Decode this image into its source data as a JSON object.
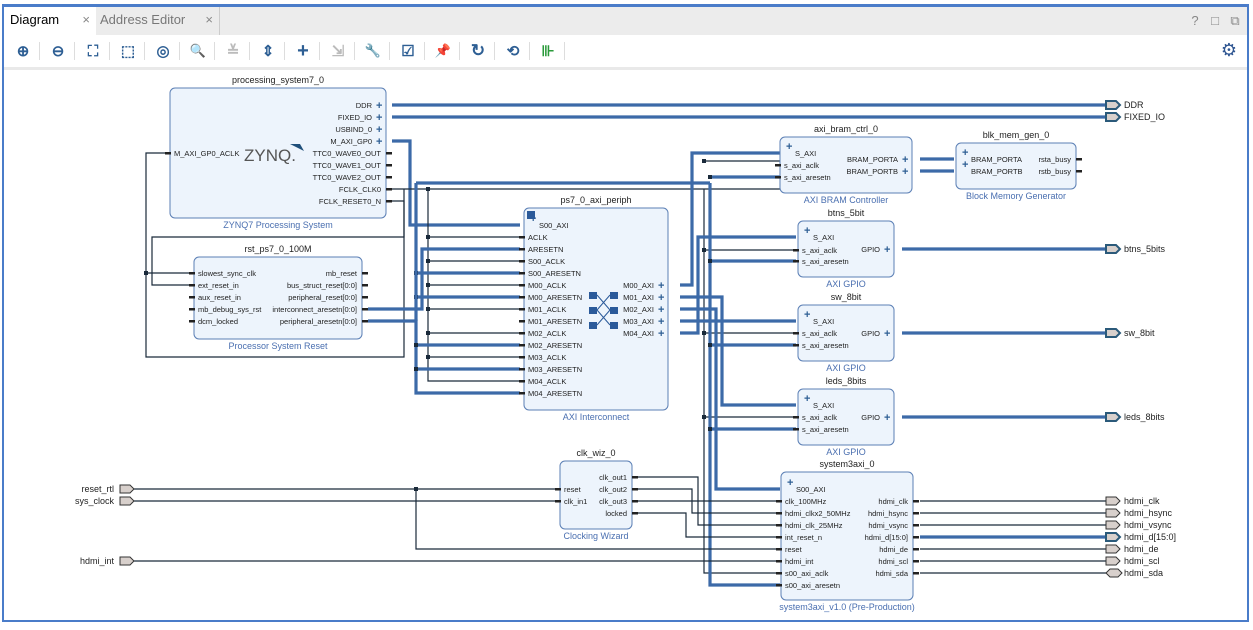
{
  "tabs": [
    {
      "label": "Diagram",
      "active": true,
      "close": "×"
    },
    {
      "label": "Address Editor",
      "active": false,
      "close": "×"
    }
  ],
  "window_controls": {
    "help": "?",
    "maximize": "□",
    "float": "⧉"
  },
  "toolbar": {
    "buttons": [
      {
        "name": "zoom-in",
        "glyph": "⊕"
      },
      {
        "name": "zoom-out",
        "glyph": "⊖"
      },
      {
        "name": "zoom-fit",
        "glyph": "⛶"
      },
      {
        "name": "zoom-area",
        "glyph": "⬚"
      },
      {
        "name": "auto-fit-selection",
        "glyph": "◎"
      },
      {
        "name": "search",
        "glyph": "🔍"
      },
      {
        "name": "collapse-all",
        "glyph": "≚"
      },
      {
        "name": "expand-all",
        "glyph": "⇕"
      },
      {
        "name": "add-ip",
        "glyph": "+"
      },
      {
        "name": "make-external",
        "glyph": "⇲"
      },
      {
        "name": "properties",
        "glyph": "🔧"
      },
      {
        "name": "validate-design",
        "glyph": "☑"
      },
      {
        "name": "pin",
        "glyph": "📌"
      },
      {
        "name": "refresh",
        "glyph": "↻"
      },
      {
        "name": "regenerate-layout",
        "glyph": "⟲"
      },
      {
        "name": "debug",
        "glyph": "⊪"
      }
    ],
    "settings_glyph": "⚙"
  },
  "diagram": {
    "blocks": {
      "ps7": {
        "instance": "processing_system7_0",
        "type": "ZYNQ7 Processing System",
        "logo": "ZYNQ.",
        "inputs": [
          "M_AXI_GP0_ACLK"
        ],
        "outputs": [
          "DDR",
          "FIXED_IO",
          "USBIND_0",
          "M_AXI_GP0",
          "TTC0_WAVE0_OUT",
          "TTC0_WAVE1_OUT",
          "TTC0_WAVE2_OUT",
          "FCLK_CLK0",
          "FCLK_RESET0_N"
        ]
      },
      "rst": {
        "instance": "rst_ps7_0_100M",
        "type": "Processor System Reset",
        "inputs": [
          "slowest_sync_clk",
          "ext_reset_in",
          "aux_reset_in",
          "mb_debug_sys_rst",
          "dcm_locked"
        ],
        "outputs": [
          "mb_reset",
          "bus_struct_reset[0:0]",
          "peripheral_reset[0:0]",
          "interconnect_aresetn[0:0]",
          "peripheral_aresetn[0:0]"
        ]
      },
      "interconnect": {
        "instance": "ps7_0_axi_periph",
        "type": "AXI Interconnect",
        "inputs": [
          "S00_AXI",
          "ACLK",
          "ARESETN",
          "S00_ACLK",
          "S00_ARESETN",
          "M00_ACLK",
          "M00_ARESETN",
          "M01_ACLK",
          "M01_ARESETN",
          "M02_ACLK",
          "M02_ARESETN",
          "M03_ACLK",
          "M03_ARESETN",
          "M04_ACLK",
          "M04_ARESETN"
        ],
        "outputs": [
          "M00_AXI",
          "M01_AXI",
          "M02_AXI",
          "M03_AXI",
          "M04_AXI"
        ]
      },
      "bram_ctrl": {
        "instance": "axi_bram_ctrl_0",
        "type": "AXI BRAM Controller",
        "inputs": [
          "S_AXI",
          "s_axi_aclk",
          "s_axi_aresetn"
        ],
        "outputs": [
          "BRAM_PORTA",
          "BRAM_PORTB"
        ]
      },
      "blk_mem": {
        "instance": "blk_mem_gen_0",
        "type": "Block Memory Generator",
        "inputs": [
          "BRAM_PORTA",
          "BRAM_PORTB"
        ],
        "outputs": [
          "rsta_busy",
          "rstb_busy"
        ]
      },
      "btns": {
        "instance": "btns_5bit",
        "type": "AXI GPIO",
        "inputs": [
          "S_AXI",
          "s_axi_aclk",
          "s_axi_aresetn"
        ],
        "outputs": [
          "GPIO"
        ]
      },
      "sw": {
        "instance": "sw_8bit",
        "type": "AXI GPIO",
        "inputs": [
          "S_AXI",
          "s_axi_aclk",
          "s_axi_aresetn"
        ],
        "outputs": [
          "GPIO"
        ]
      },
      "leds": {
        "instance": "leds_8bits",
        "type": "AXI GPIO",
        "inputs": [
          "S_AXI",
          "s_axi_aclk",
          "s_axi_aresetn"
        ],
        "outputs": [
          "GPIO"
        ]
      },
      "clk_wiz": {
        "instance": "clk_wiz_0",
        "type": "Clocking Wizard",
        "inputs": [
          "reset",
          "clk_in1"
        ],
        "outputs": [
          "clk_out1",
          "clk_out2",
          "clk_out3",
          "locked"
        ]
      },
      "sys3axi": {
        "instance": "system3axi_0",
        "type": "system3axi_v1.0 (Pre-Production)",
        "inputs": [
          "S00_AXI",
          "clk_100MHz",
          "hdmi_clkx2_50MHz",
          "hdmi_clk_25MHz",
          "int_reset_n",
          "reset",
          "hdmi_int",
          "s00_axi_aclk",
          "s00_axi_aresetn"
        ],
        "outputs": [
          "hdmi_clk",
          "hdmi_hsync",
          "hdmi_vsync",
          "hdmi_d[15:0]",
          "hdmi_de",
          "hdmi_scl",
          "hdmi_sda"
        ]
      }
    },
    "external_inputs": [
      "reset_rtl",
      "sys_clock",
      "hdmi_int"
    ],
    "external_outputs_top": [
      "DDR",
      "FIXED_IO",
      "btns_5bits",
      "sw_8bit",
      "leds_8bits"
    ],
    "external_outputs_hdmi": [
      "hdmi_clk",
      "hdmi_hsync",
      "hdmi_vsync",
      "hdmi_d[15:0]",
      "hdmi_de",
      "hdmi_scl",
      "hdmi_sda"
    ],
    "colors": {
      "bus": "#3c6aa8",
      "wire": "#1a2a3a",
      "block_fill": "#edf4fc",
      "block_border": "#5b7fb5",
      "port_fill": "#d8d0cc"
    }
  }
}
